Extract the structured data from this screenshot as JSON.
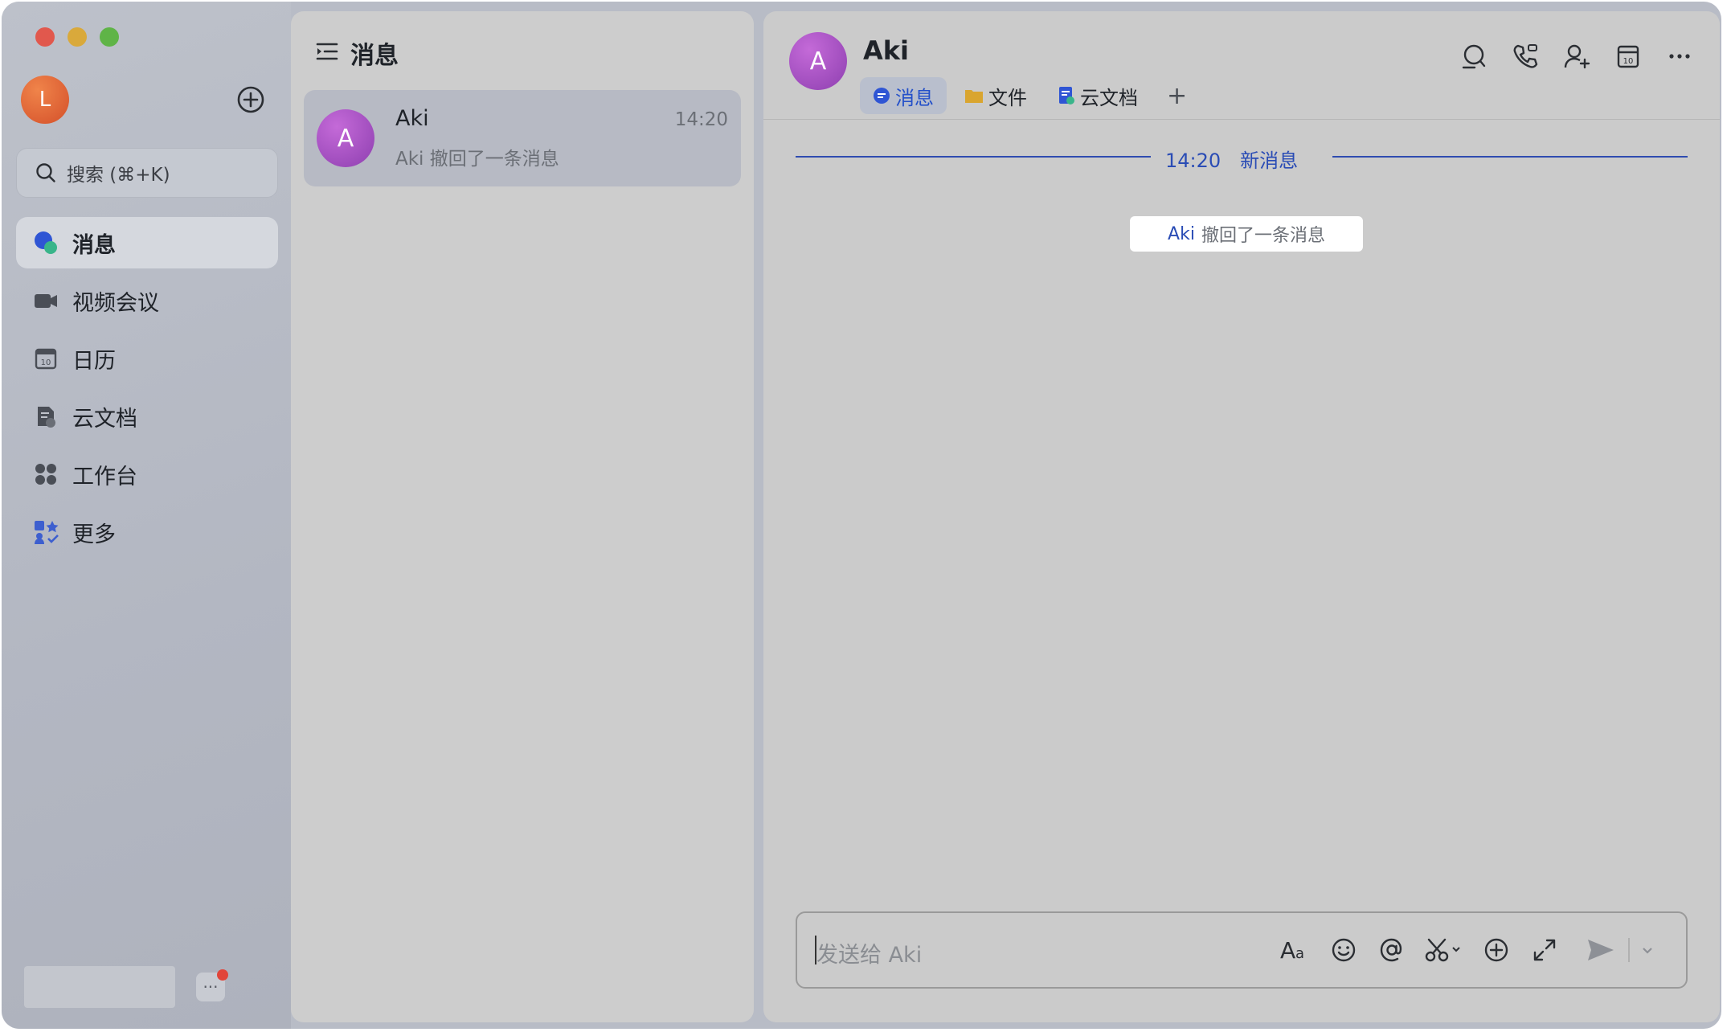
{
  "sidebar": {
    "user_initial": "L",
    "search_placeholder": "搜索 (⌘+K)",
    "items": [
      {
        "label": "消息",
        "icon": "chat-bubble-icon"
      },
      {
        "label": "视频会议",
        "icon": "video-camera-icon"
      },
      {
        "label": "日历",
        "icon": "calendar-icon"
      },
      {
        "label": "云文档",
        "icon": "cloud-doc-icon"
      },
      {
        "label": "工作台",
        "icon": "apps-grid-icon"
      },
      {
        "label": "更多",
        "icon": "more-apps-icon"
      }
    ],
    "more_dots": "···"
  },
  "list": {
    "title": "消息",
    "chats": [
      {
        "initial": "A",
        "name": "Aki",
        "time": "14:20",
        "preview": "Aki 撤回了一条消息"
      }
    ]
  },
  "chat": {
    "initial": "A",
    "name": "Aki",
    "tabs": [
      {
        "label": "消息",
        "icon": "message-icon"
      },
      {
        "label": "文件",
        "icon": "folder-icon"
      },
      {
        "label": "云文档",
        "icon": "doc-icon"
      }
    ],
    "add_tab": "+",
    "divider_time": "14:20",
    "divider_label": "新消息",
    "recall_name": "Aki",
    "recall_text": "撤回了一条消息",
    "composer_placeholder": "发送给 Aki",
    "colors": {
      "accent": "#2a4cb5",
      "avatar": "#a24fc2",
      "me_avatar": "#e06a3a"
    }
  }
}
